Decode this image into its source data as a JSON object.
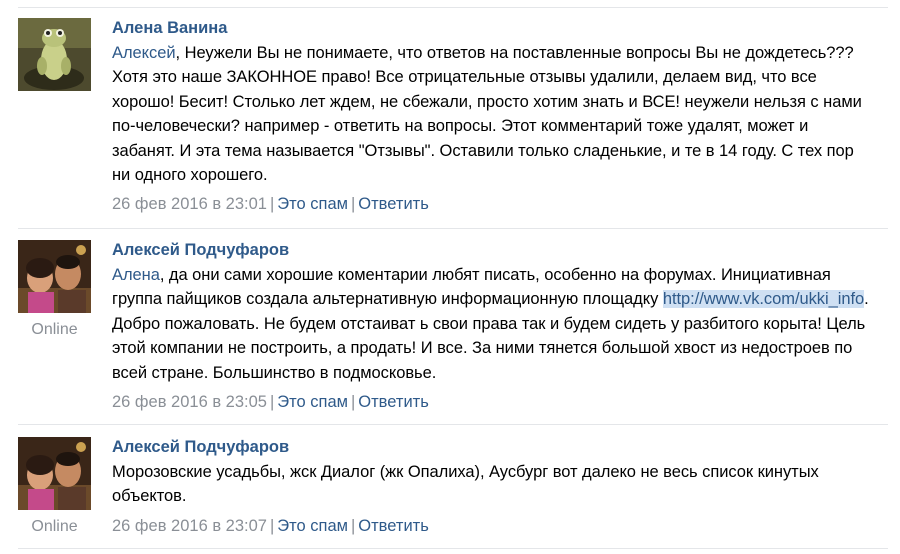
{
  "comments": [
    {
      "author": "Алена Ванина",
      "reply_to": "Алексей",
      "text": ", Неужели Вы не понимаете, что ответов на поставленные вопросы Вы не дождетесь??? Хотя это наше ЗАКОННОЕ право! Все отрицательные отзывы удалили, делаем вид, что все хорошо! Бесит! Столько лет ждем, не сбежали, просто хотим знать и ВСЕ! неужели нельзя с нами по-человечески? например - ответить на вопросы. Этот комментарий тоже удалят, может и забанят. И эта тема называется \"Отзывы\". Оставили только сладенькие, и те в 14 году. С тех пор ни одного хорошего.",
      "date": "26 фев 2016 в 23:01",
      "spam_label": "Это спам",
      "reply_label": "Ответить"
    },
    {
      "author": "Алексей Подчуфаров",
      "status": "Online",
      "reply_to": "Алена",
      "text_before": ", да они сами хорошие коментарии любят писать, особенно на форумах. Инициативная группа пайщиков создала альтернативную информационную площадку ",
      "link": "http://www.vk.com/ukki_info",
      "text_after": ". Добро пожаловать. Не будем отстаиват ь свои права так и будем сидеть у разбитого корыта! Цель этой компании не построить, а продать! И все. За ними тянется большой хвост из недостроев по всей стране. Большинство в подмосковье.",
      "date": "26 фев 2016 в 23:05",
      "spam_label": "Это спам",
      "reply_label": "Ответить"
    },
    {
      "author": "Алексей Подчуфаров",
      "status": "Online",
      "text": "Морозовские усадьбы, жск Диалог (жк Опалиха), Аусбург вот далеко не весь список кинутых объектов.",
      "date": "26 фев 2016 в 23:07",
      "spam_label": "Это спам",
      "reply_label": "Ответить"
    }
  ],
  "separator": "|",
  "colors": {
    "author": "#2f5a8a",
    "meta": "#8a8f96",
    "divider": "#e4e6e9",
    "link_highlight": "#cfe0f3"
  }
}
